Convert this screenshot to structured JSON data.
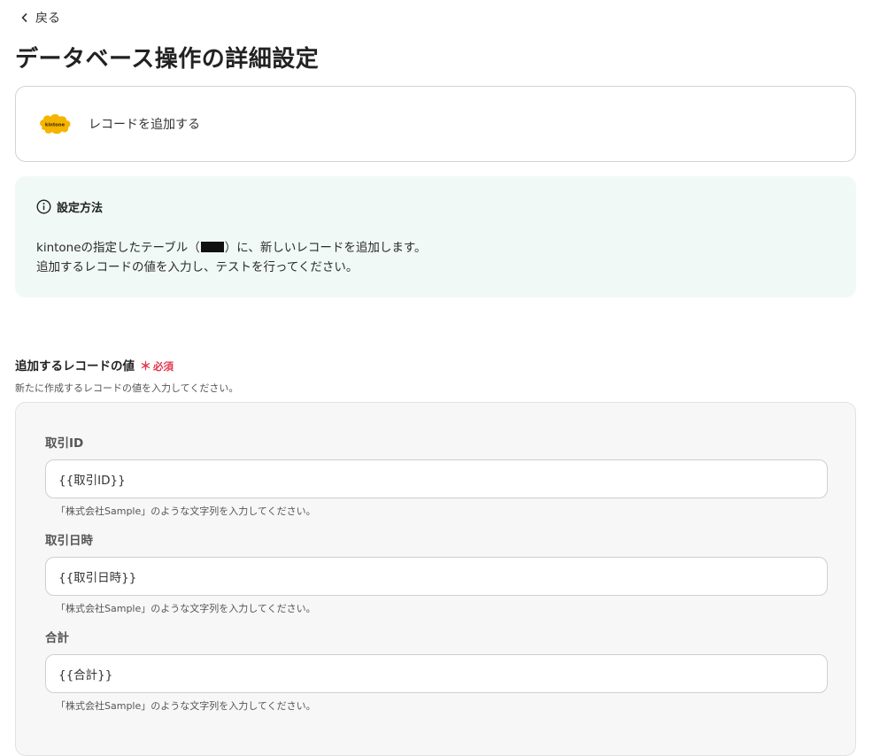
{
  "nav": {
    "back_label": "戻る"
  },
  "page": {
    "title": "データベース操作の詳細設定"
  },
  "action": {
    "label": "レコードを追加する",
    "logo_text": "kintone"
  },
  "info": {
    "title": "設定方法",
    "line1_before": "kintoneの指定したテーブル（",
    "line1_after": "）に、新しいレコードを追加します。",
    "line2": "追加するレコードの値を入力し、テストを行ってください。"
  },
  "section": {
    "label": "追加するレコードの値",
    "required_star": "＊",
    "required_text": "必須",
    "description": "新たに作成するレコードの値を入力してください。"
  },
  "fields": [
    {
      "label": "取引ID",
      "value": "{{取引ID}}",
      "hint": "「株式会社Sample」のような文字列を入力してください。"
    },
    {
      "label": "取引日時",
      "value": "{{取引日時}}",
      "hint": "「株式会社Sample」のような文字列を入力してください。"
    },
    {
      "label": "合計",
      "value": "{{合計}}",
      "hint": "「株式会社Sample」のような文字列を入力してください。"
    }
  ],
  "colors": {
    "info_bg": "#f1f9f7",
    "required": "#e2384d",
    "kintone_yellow": "#f5b400"
  }
}
